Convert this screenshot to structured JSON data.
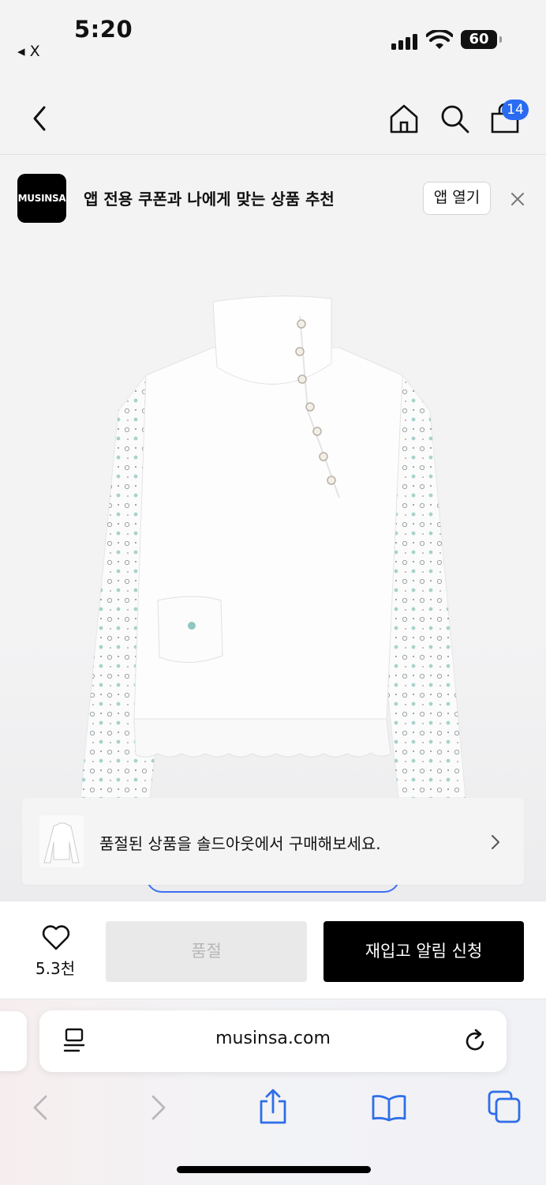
{
  "status_bar": {
    "time": "5:20",
    "back_label": "◂ X",
    "battery": "60"
  },
  "nav": {
    "cart_count": "14"
  },
  "app_banner": {
    "logo_text": "MUSINSA",
    "text": "앱 전용 쿠폰과 나에게 맞는 상품 추천",
    "open_button": "앱 열기"
  },
  "soldout_notice": {
    "text": "품절된 상품을 솔드아웃에서 구매해보세요."
  },
  "action_bar": {
    "like_count": "5.3천",
    "soldout_label": "품절",
    "restock_label": "재입고 알림 신청"
  },
  "browser": {
    "url": "musinsa.com"
  },
  "colors": {
    "accent_blue": "#2a6bf2",
    "black": "#000000",
    "disabled_bg": "#e9e9ea",
    "disabled_text": "#b6b6b8",
    "safari_blue": "#2f6ee8"
  },
  "icons": {
    "nav": [
      "back-icon",
      "home-icon",
      "search-icon",
      "shopping-bag-icon"
    ],
    "browser": [
      "reader-icon",
      "reload-icon",
      "back-arrow-icon",
      "forward-arrow-icon",
      "share-icon",
      "bookmarks-icon",
      "tabs-icon"
    ]
  }
}
